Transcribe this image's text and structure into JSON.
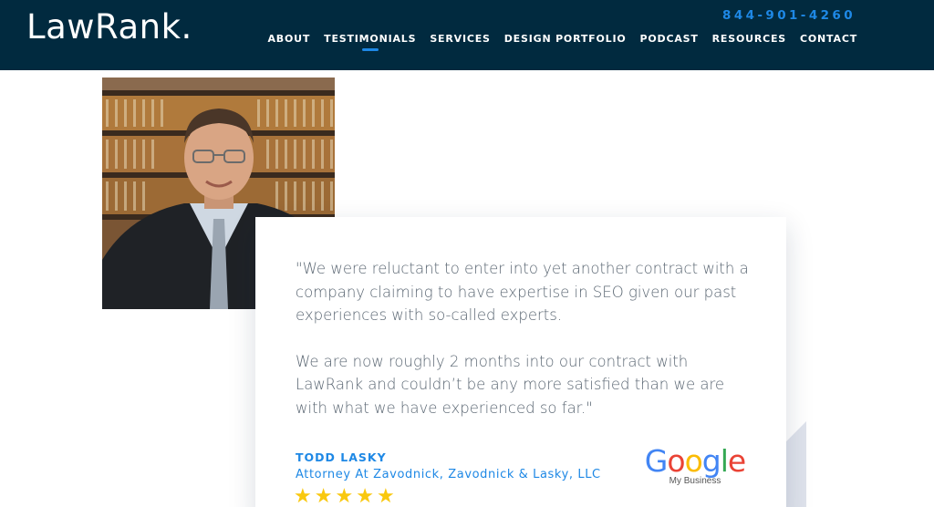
{
  "header": {
    "logo": "LawRank.",
    "phone": "844-901-4260",
    "nav": [
      {
        "label": "ABOUT"
      },
      {
        "label": "TESTIMONIALS"
      },
      {
        "label": "SERVICES"
      },
      {
        "label": "DESIGN PORTFOLIO"
      },
      {
        "label": "PODCAST"
      },
      {
        "label": "RESOURCES"
      },
      {
        "label": "CONTACT"
      }
    ],
    "active_nav": "TESTIMONIALS"
  },
  "testimonial": {
    "quote_p1": "\"We were reluctant to enter into yet another contract with a company claiming to have expertise in SEO given our past experiences with so-called experts.",
    "quote_p2": "We are now roughly 2 months into our contract with LawRank and couldn’t be any more satisfied than we are with what we have experienced so far.\"",
    "author": "TODD LASKY",
    "role": "Attorney At Zavodnick, Zavodnick & Lasky, LLC",
    "rating": 5,
    "rating_max": 5,
    "badge": {
      "word": "Google",
      "sub": "My Business"
    }
  },
  "colors": {
    "header_bg": "#012a3f",
    "accent": "#1e88e5",
    "star": "#f9c80e",
    "google_blue": "#4285f4",
    "google_red": "#ea4335",
    "google_yellow": "#fbbc05",
    "google_green": "#34a853"
  }
}
